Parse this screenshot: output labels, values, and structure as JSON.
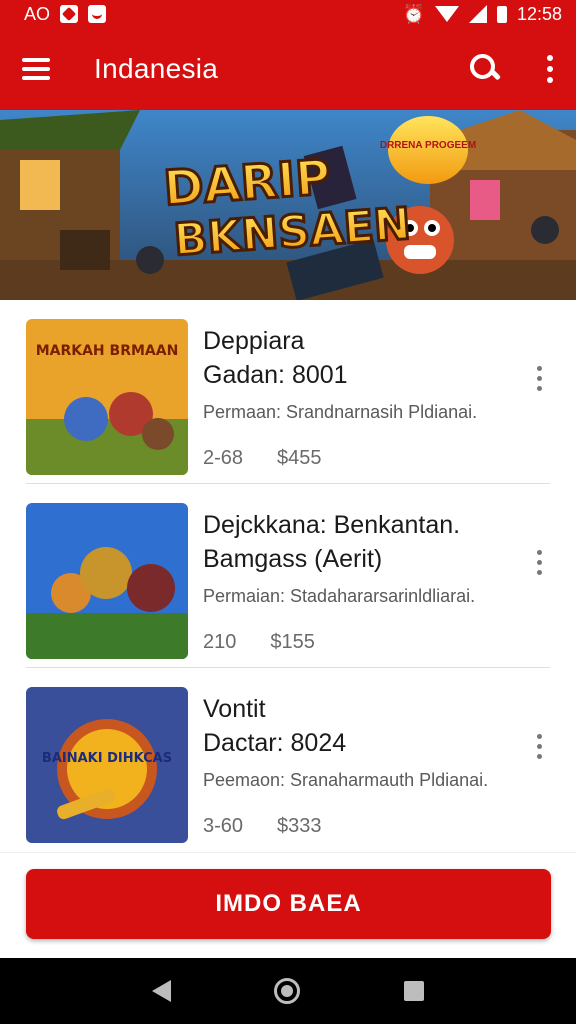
{
  "status_bar": {
    "carrier": "AO",
    "time": "12:58",
    "icons": [
      "notification-icon",
      "notification-icon",
      "alarm-icon",
      "wifi-icon",
      "signal-icon",
      "battery-icon"
    ]
  },
  "app_bar": {
    "title": "Indanesia",
    "icons": [
      "menu-icon",
      "search-icon",
      "overflow-menu-icon"
    ]
  },
  "banner": {
    "headline_line1": "DARIP",
    "headline_line2": "BKNSAEN",
    "badge_text": "DRRENA PROGEEM"
  },
  "items": [
    {
      "thumb_text": "MARKAH BRMAAN",
      "title_line1": "Deppiara",
      "title_line2": "Gadan: 8001",
      "description": "Permaan: Srandnarnasih Pldianai.",
      "count": "2-68",
      "price": "$455"
    },
    {
      "thumb_text": "",
      "title_line1": "Dejckkana: Benkantan.",
      "title_line2": "Bamgass (Aerit)",
      "description": "Permaian: Stadahararsarinldliarai.",
      "count": "210",
      "price": "$155"
    },
    {
      "thumb_text": "BAINAKI DIHKCAS",
      "title_line1": "Vontit",
      "title_line2": "Dactar: 8024",
      "description": "Peemaon: Sranaharmauth Pldianai.",
      "count": "3-60",
      "price": "$333"
    }
  ],
  "cta": {
    "label": "IMDO BAEA"
  },
  "colors": {
    "primary": "#d50f0f",
    "nav_bar": "#000000",
    "text": "#1b1b1b"
  }
}
